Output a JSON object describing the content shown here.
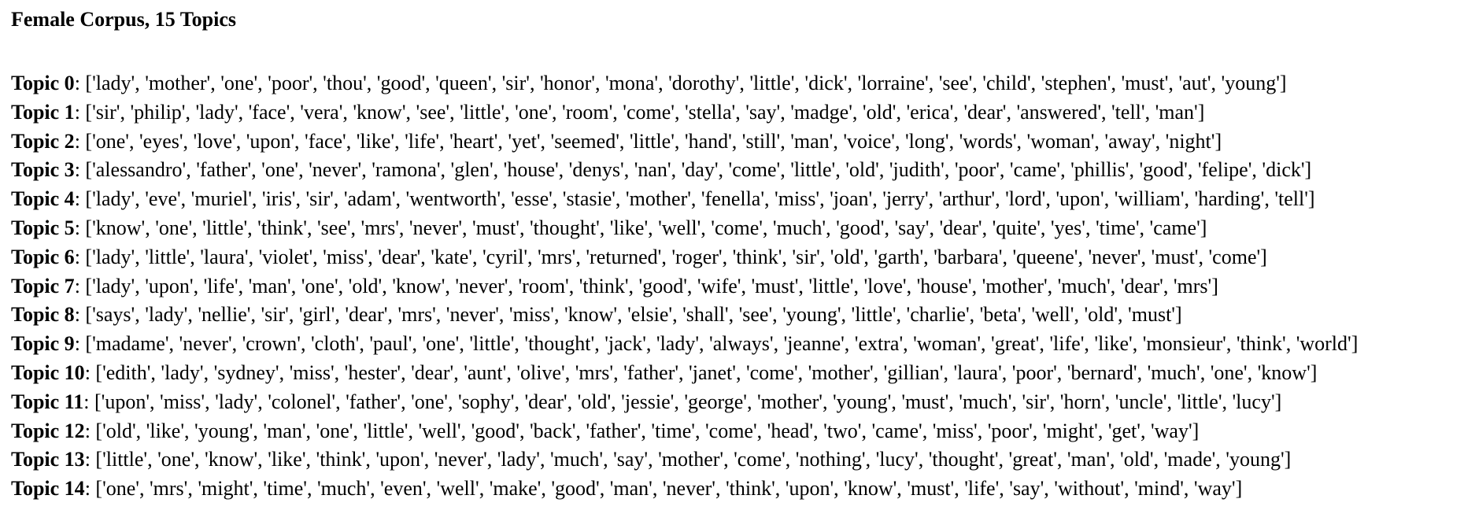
{
  "document": {
    "title": "Female Corpus, 15 Topics",
    "separator": ": ",
    "topics": [
      {
        "label": "Topic 0",
        "words": "['lady', 'mother', 'one', 'poor', 'thou', 'good', 'queen', 'sir', 'honor', 'mona', 'dorothy', 'little', 'dick', 'lorraine', 'see', 'child', 'stephen', 'must', 'aut', 'young']"
      },
      {
        "label": "Topic 1",
        "words": "['sir', 'philip', 'lady', 'face', 'vera', 'know', 'see', 'little', 'one', 'room', 'come', 'stella', 'say', 'madge', 'old', 'erica', 'dear', 'answered', 'tell', 'man']"
      },
      {
        "label": "Topic 2",
        "words": "['one', 'eyes', 'love', 'upon', 'face', 'like', 'life', 'heart', 'yet', 'seemed', 'little', 'hand', 'still', 'man', 'voice', 'long', 'words', 'woman', 'away', 'night']"
      },
      {
        "label": "Topic 3",
        "words": "['alessandro', 'father', 'one', 'never', 'ramona', 'glen', 'house', 'denys', 'nan', 'day', 'come', 'little', 'old', 'judith', 'poor', 'came', 'phillis', 'good', 'felipe', 'dick']"
      },
      {
        "label": "Topic 4",
        "words": "['lady', 'eve', 'muriel', 'iris', 'sir', 'adam', 'wentworth', 'esse', 'stasie', 'mother', 'fenella', 'miss', 'joan', 'jerry', 'arthur', 'lord', 'upon', 'william', 'harding', 'tell']"
      },
      {
        "label": "Topic 5",
        "words": "['know', 'one', 'little', 'think', 'see', 'mrs', 'never', 'must', 'thought', 'like', 'well', 'come', 'much', 'good', 'say', 'dear', 'quite', 'yes', 'time', 'came']"
      },
      {
        "label": "Topic 6",
        "words": "['lady', 'little', 'laura', 'violet', 'miss', 'dear', 'kate', 'cyril', 'mrs', 'returned', 'roger', 'think', 'sir', 'old', 'garth', 'barbara', 'queene', 'never', 'must', 'come']"
      },
      {
        "label": "Topic 7",
        "words": "['lady', 'upon', 'life', 'man', 'one', 'old', 'know', 'never', 'room', 'think', 'good', 'wife', 'must', 'little', 'love', 'house', 'mother', 'much', 'dear', 'mrs']"
      },
      {
        "label": "Topic 8",
        "words": "['says', 'lady', 'nellie', 'sir', 'girl', 'dear', 'mrs', 'never', 'miss', 'know', 'elsie', 'shall', 'see', 'young', 'little', 'charlie', 'beta', 'well', 'old', 'must']"
      },
      {
        "label": "Topic 9",
        "words": "['madame', 'never', 'crown', 'cloth', 'paul', 'one', 'little', 'thought', 'jack', 'lady', 'always', 'jeanne', 'extra', 'woman', 'great', 'life', 'like', 'monsieur', 'think', 'world']"
      },
      {
        "label": "Topic 10",
        "words": "['edith', 'lady', 'sydney', 'miss', 'hester', 'dear', 'aunt', 'olive', 'mrs', 'father', 'janet', 'come', 'mother', 'gillian', 'laura', 'poor', 'bernard', 'much', 'one', 'know']"
      },
      {
        "label": "Topic 11",
        "words": "['upon', 'miss', 'lady', 'colonel', 'father', 'one', 'sophy', 'dear', 'old', 'jessie', 'george', 'mother', 'young', 'must', 'much', 'sir', 'horn', 'uncle', 'little', 'lucy']"
      },
      {
        "label": "Topic 12",
        "words": "['old', 'like', 'young', 'man', 'one', 'little', 'well', 'good', 'back', 'father', 'time', 'come', 'head', 'two', 'came', 'miss', 'poor', 'might', 'get', 'way']"
      },
      {
        "label": "Topic 13",
        "words": "['little', 'one', 'know', 'like', 'think', 'upon', 'never', 'lady', 'much', 'say', 'mother', 'come', 'nothing', 'lucy', 'thought', 'great', 'man', 'old', 'made', 'young']"
      },
      {
        "label": "Topic 14",
        "words": "['one', 'mrs', 'might', 'time', 'much', 'even', 'well', 'make', 'good', 'man', 'never', 'think', 'upon', 'know', 'must', 'life', 'say', 'without', 'mind', 'way']"
      }
    ]
  }
}
